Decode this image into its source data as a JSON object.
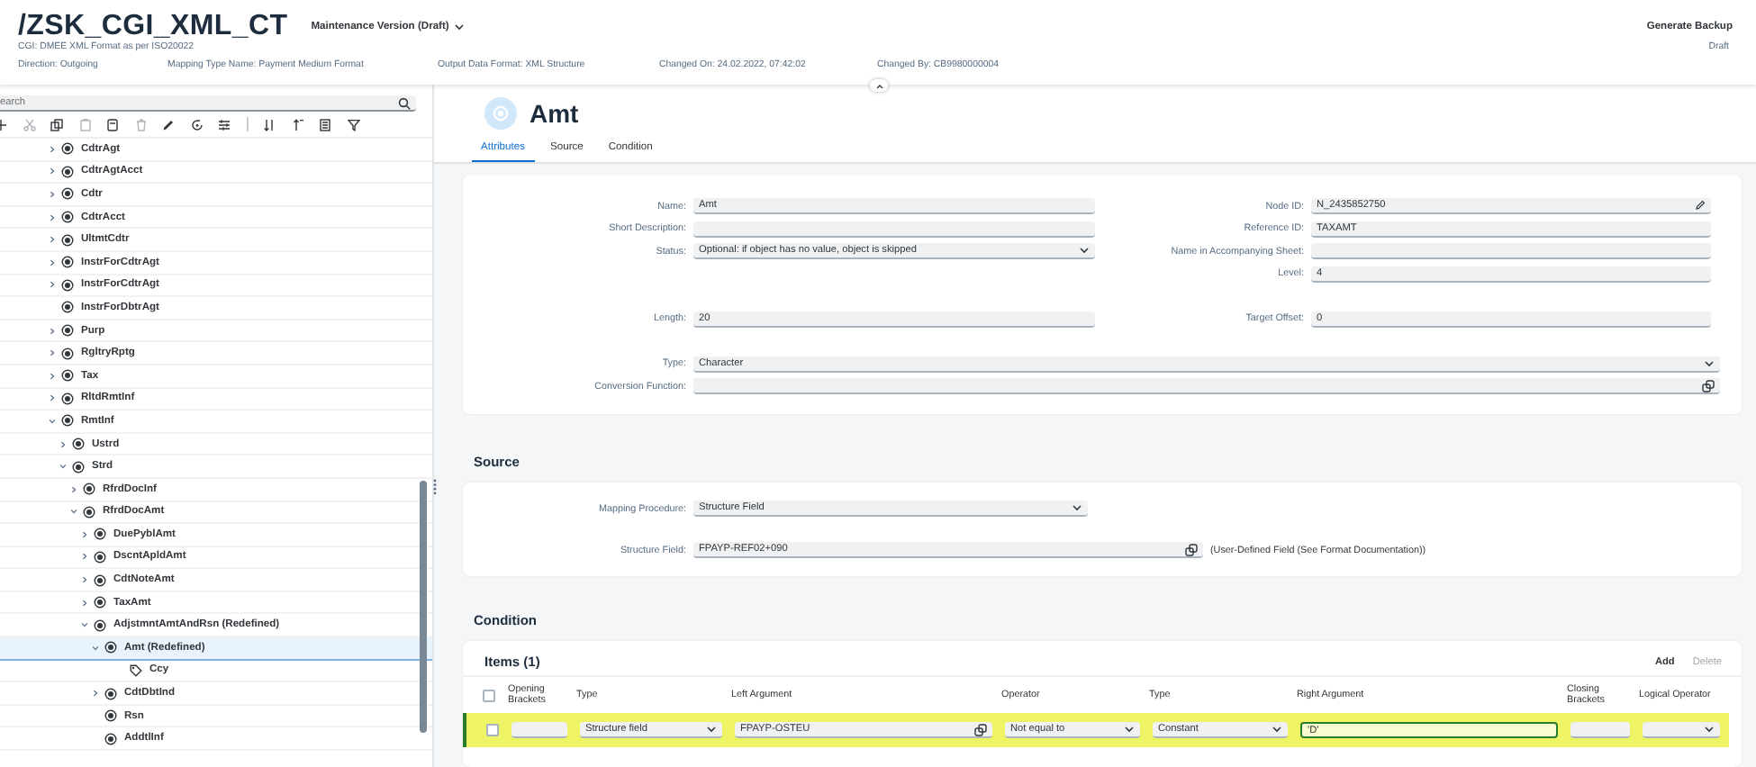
{
  "header": {
    "title": "/ZSK_CGI_XML_CT",
    "version": "Maintenance Version (Draft)",
    "subtitle": "CGI: DMEE XML Format as per ISO20022",
    "meta": [
      "Direction: Outgoing",
      "Mapping Type Name: Payment Medium Format",
      "Output Data Format: XML Structure",
      "Changed On: 24.02.2022, 07:42:02",
      "Changed By: CB9980000004"
    ],
    "action": "Generate Backup",
    "status": "Draft"
  },
  "tree": {
    "search": {
      "placeholder": "earch"
    },
    "items": [
      {
        "label": "CdtrAgt",
        "kind": "node",
        "expanded": false,
        "selected": false
      },
      {
        "label": "CdtrAgtAcct",
        "kind": "node",
        "expanded": false,
        "selected": false
      },
      {
        "label": "Cdtr",
        "kind": "node",
        "expanded": false,
        "selected": false
      },
      {
        "label": "CdtrAcct",
        "kind": "node",
        "expanded": false,
        "selected": false
      },
      {
        "label": "UltmtCdtr",
        "kind": "node",
        "expanded": false,
        "selected": false
      },
      {
        "label": "InstrForCdtrAgt",
        "kind": "node",
        "expanded": false,
        "selected": false
      },
      {
        "label": "InstrForCdtrAgt",
        "kind": "node",
        "expanded": false,
        "selected": false
      },
      {
        "label": "InstrForDbtrAgt",
        "kind": "leaf",
        "selected": false
      },
      {
        "label": "Purp",
        "kind": "node",
        "expanded": false,
        "selected": false
      },
      {
        "label": "RgltryRptg",
        "kind": "node",
        "expanded": false,
        "selected": false
      },
      {
        "label": "Tax",
        "kind": "node",
        "expanded": false,
        "selected": false
      },
      {
        "label": "RltdRmtInf",
        "kind": "node",
        "expanded": false,
        "selected": false
      },
      {
        "label": "RmtInf",
        "kind": "node",
        "expanded": true,
        "selected": false,
        "children": [
          {
            "label": "Ustrd",
            "kind": "node",
            "expanded": false,
            "selected": false
          },
          {
            "label": "Strd",
            "kind": "node",
            "expanded": true,
            "selected": false,
            "children": [
              {
                "label": "RfrdDocInf",
                "kind": "node",
                "expanded": false,
                "selected": false
              },
              {
                "label": "RfrdDocAmt",
                "kind": "node",
                "expanded": true,
                "selected": false,
                "children": [
                  {
                    "label": "DuePyblAmt",
                    "kind": "node",
                    "expanded": false,
                    "selected": false
                  },
                  {
                    "label": "DscntApldAmt",
                    "kind": "node",
                    "expanded": false,
                    "selected": false
                  },
                  {
                    "label": "CdtNoteAmt",
                    "kind": "node",
                    "expanded": false,
                    "selected": false
                  },
                  {
                    "label": "TaxAmt",
                    "kind": "node",
                    "expanded": false,
                    "selected": false
                  },
                  {
                    "label": "AdjstmntAmtAndRsn (Redefined)",
                    "kind": "node",
                    "expanded": true,
                    "selected": false,
                    "children": [
                      {
                        "label": "Amt (Redefined)",
                        "kind": "node",
                        "expanded": true,
                        "selected": true,
                        "children": [
                          {
                            "label": "Ccy",
                            "kind": "attribute",
                            "selected": false
                          }
                        ]
                      },
                      {
                        "label": "CdtDbtInd",
                        "kind": "node",
                        "expanded": false,
                        "selected": false
                      },
                      {
                        "label": "Rsn",
                        "kind": "leaf",
                        "selected": false
                      },
                      {
                        "label": "AddtlInf",
                        "kind": "leaf",
                        "selected": false
                      }
                    ]
                  }
                ]
              }
            ]
          }
        ]
      }
    ]
  },
  "detail": {
    "title": "Amt",
    "tabs": [
      {
        "label": "Attributes",
        "selected": true
      },
      {
        "label": "Source",
        "selected": false
      },
      {
        "label": "Condition",
        "selected": false
      }
    ],
    "attributes": {
      "groups": [
        {
          "left": [
            {
              "label": "Name:",
              "kind": "input",
              "value": "Amt"
            },
            {
              "label": "Short Description:",
              "kind": "input"
            },
            {
              "label": "Status:",
              "kind": "select",
              "value": "Optional: if object has no value, object is skipped"
            }
          ],
          "right": [
            {
              "label": "Node ID:",
              "kind": "edit",
              "value": "N_2435852750"
            },
            {
              "label": "Reference ID:",
              "kind": "input",
              "value": "TAXAMT"
            },
            {
              "label": "Name in Accompanying Sheet:",
              "kind": "input"
            },
            {
              "label": "Level:",
              "kind": "input",
              "value": "4"
            }
          ]
        },
        {
          "left": [
            {
              "label": "Length:",
              "kind": "input",
              "value": "20"
            }
          ],
          "right": [
            {
              "label": "Target Offset:",
              "kind": "input",
              "value": "0"
            }
          ]
        },
        {
          "wide": [
            {
              "label": "Type:",
              "kind": "select",
              "value": "Character"
            },
            {
              "label": "Conversion Function:",
              "kind": "value-help"
            }
          ]
        }
      ]
    },
    "source": {
      "title": "Source",
      "fields": [
        {
          "label": "Mapping Procedure:",
          "kind": "select",
          "value": "Structure Field"
        },
        {
          "label": "Structure Field:",
          "kind": "value-help",
          "value": "FPAYP-REF02+090",
          "note": "(User-Defined Field (See Format Documentation))"
        }
      ]
    },
    "condition": {
      "title": "Condition",
      "items_title": "Items (1)",
      "actions": [
        {
          "label": "Add",
          "disabled": false
        },
        {
          "label": "Delete",
          "disabled": true
        }
      ],
      "all_checked": false,
      "columns": [
        "Opening Brackets",
        "Type",
        "Left Argument",
        "Operator",
        "Type",
        "Right Argument",
        "Closing Brackets",
        "Logical Operator"
      ],
      "rows": [
        {
          "highlighted": true,
          "checked": false,
          "cells": [
            {
              "kind": "input"
            },
            {
              "kind": "select",
              "value": "Structure field"
            },
            {
              "kind": "value-help",
              "value": "FPAYP-OSTEU"
            },
            {
              "kind": "select",
              "value": "Not equal to"
            },
            {
              "kind": "select",
              "value": "Constant"
            },
            {
              "kind": "input",
              "value": "'D'",
              "focused": true
            },
            {
              "kind": "input"
            },
            {
              "kind": "select"
            }
          ]
        }
      ]
    }
  }
}
